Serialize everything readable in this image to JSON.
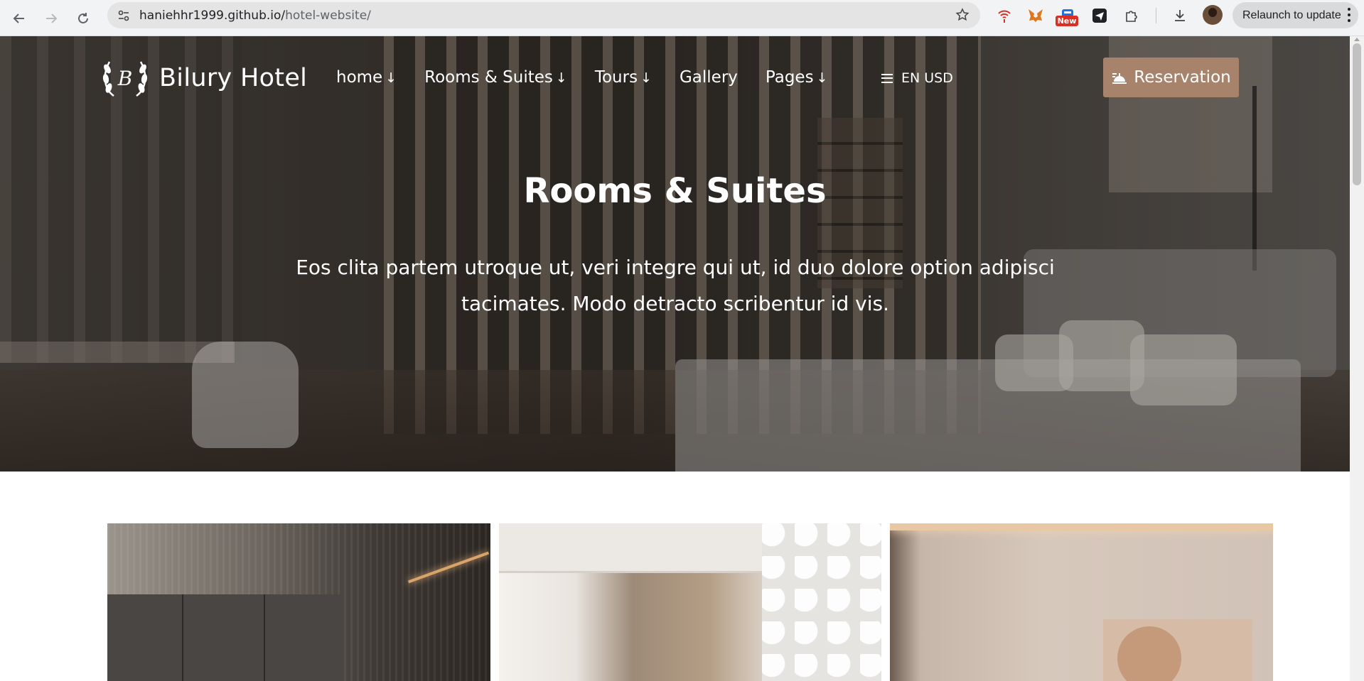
{
  "browser": {
    "url_host": "haniehhr1999.github.io/",
    "url_path": "hotel-website/",
    "new_badge": "New",
    "relaunch_label": "Relaunch to update"
  },
  "site": {
    "brand": "Bilury Hotel",
    "logo_letter": "B",
    "nav": [
      {
        "label": "home",
        "has_dropdown": true
      },
      {
        "label": "Rooms & Suites",
        "has_dropdown": true
      },
      {
        "label": "Tours",
        "has_dropdown": true
      },
      {
        "label": "Gallery",
        "has_dropdown": false
      },
      {
        "label": "Pages",
        "has_dropdown": true
      }
    ],
    "dropdown_arrow": "↓",
    "lang_currency": "EN USD",
    "reservation_label": "Reservation",
    "accent_color": "#a6836a"
  },
  "hero": {
    "title": "Rooms & Suites",
    "description_line1": "Eos clita partem utroque ut, veri integre qui ut, id duo dolore option adipisci",
    "description_line2": "tacimates. Modo detracto scribentur id vis."
  }
}
